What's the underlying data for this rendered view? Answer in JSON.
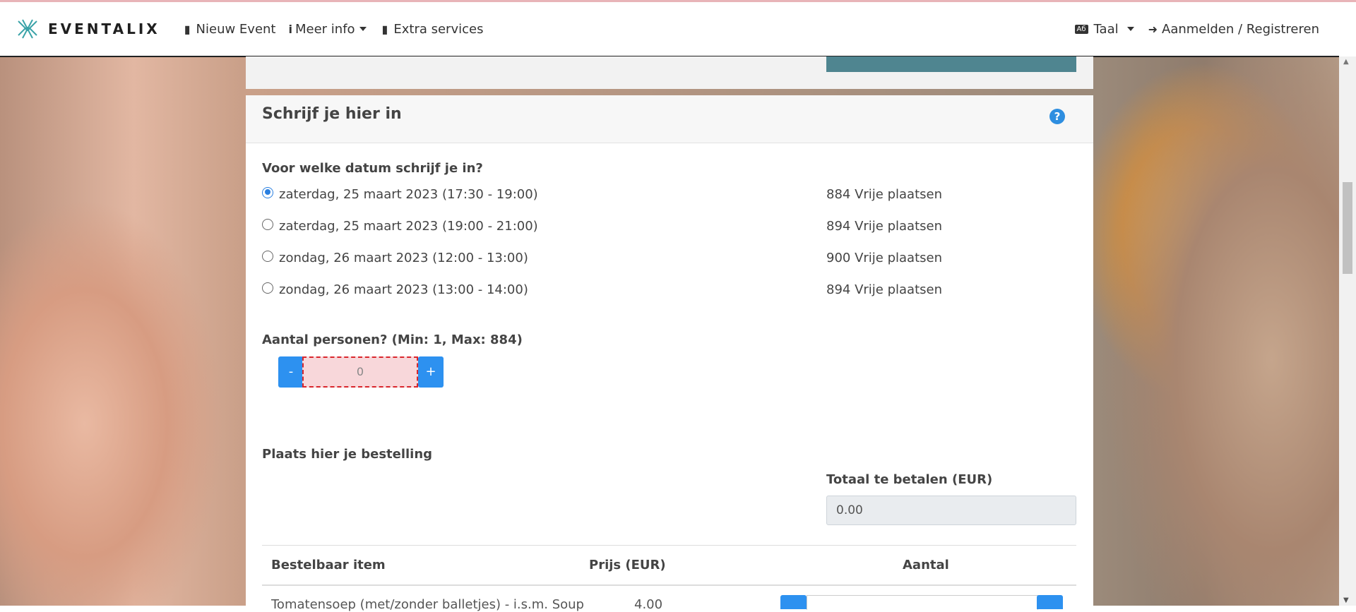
{
  "colors": {
    "accent": "#2d91f0",
    "teal_bar": "#4f8590",
    "error_border": "#d9262c"
  },
  "navbar": {
    "brand": "EVENTALIX",
    "items": [
      {
        "label": "Nieuw Event",
        "icon": "file-icon"
      },
      {
        "label": "Meer info",
        "icon": "info-icon",
        "dropdown": true
      },
      {
        "label": "Extra services",
        "icon": "file-icon"
      }
    ],
    "language": {
      "label": "Taal",
      "icon": "language-icon"
    },
    "login": {
      "label": "Aanmelden / Registreren",
      "icon": "sign-in-icon"
    }
  },
  "card": {
    "title": "Schrijf je hier in",
    "date_question": "Voor welke datum schrijf je in?",
    "dates": [
      {
        "label": "zaterdag, 25 maart 2023 (17:30 - 19:00)",
        "free": "884 Vrije plaatsen",
        "selected": true
      },
      {
        "label": "zaterdag, 25 maart 2023 (19:00 - 21:00)",
        "free": "894 Vrije plaatsen",
        "selected": false
      },
      {
        "label": "zondag, 26 maart 2023 (12:00 - 13:00)",
        "free": "900 Vrije plaatsen",
        "selected": false
      },
      {
        "label": "zondag, 26 maart 2023 (13:00 - 14:00)",
        "free": "894 Vrije plaatsen",
        "selected": false
      }
    ],
    "persons_label": "Aantal personen? (Min: 1, Max: 884)",
    "persons": {
      "minus": "-",
      "value": "0",
      "plus": "+"
    },
    "order_label": "Plaats hier je bestelling",
    "total_label": "Totaal te betalen (EUR)",
    "total_value": "0.00",
    "table": {
      "headers": [
        "Bestelbaar item",
        "Prijs (EUR)",
        "Aantal"
      ],
      "rows": [
        {
          "item": "Tomatensoep (met/zonder balletjes) - i.s.m. Soup",
          "price": "4.00"
        }
      ]
    }
  }
}
